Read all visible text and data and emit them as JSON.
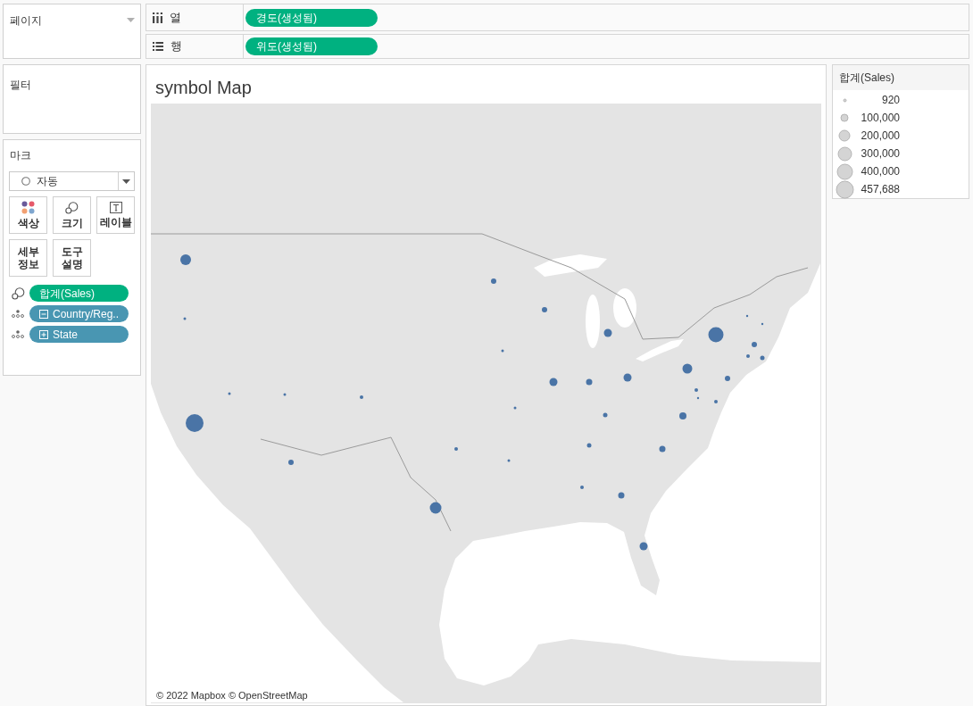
{
  "pages_card": {
    "title": "페이지"
  },
  "filters_card": {
    "title": "필터"
  },
  "marks_card": {
    "title": "마크",
    "mark_type": {
      "value": "자동"
    },
    "buttons": [
      {
        "kind": "color",
        "label": "색상"
      },
      {
        "kind": "size",
        "label": "크기"
      },
      {
        "kind": "label",
        "label": "레이블"
      },
      {
        "kind": "detail",
        "label": "세부 정보"
      },
      {
        "kind": "tooltip",
        "label": "도구 설명"
      }
    ],
    "fields": [
      {
        "kind": "size",
        "label": "합계(Sales)",
        "color": "#00b180"
      },
      {
        "kind": "detail",
        "label": "Country/Reg..",
        "color": "#4996b2",
        "expanded": true
      },
      {
        "kind": "detail",
        "label": "State",
        "color": "#4996b2",
        "expanded": false
      }
    ]
  },
  "shelves": [
    {
      "kind": "columns",
      "label": "열",
      "pills": [
        "경도(생성됨)"
      ]
    },
    {
      "kind": "rows",
      "label": "행",
      "pills": [
        "위도(생성됨)"
      ]
    }
  ],
  "view": {
    "title": "symbol Map",
    "attribution": "© 2022 Mapbox © OpenStreetMap"
  },
  "legend": {
    "title": "합계(Sales)",
    "items": [
      "920",
      "100,000",
      "200,000",
      "300,000",
      "400,000",
      "457,688"
    ]
  }
}
